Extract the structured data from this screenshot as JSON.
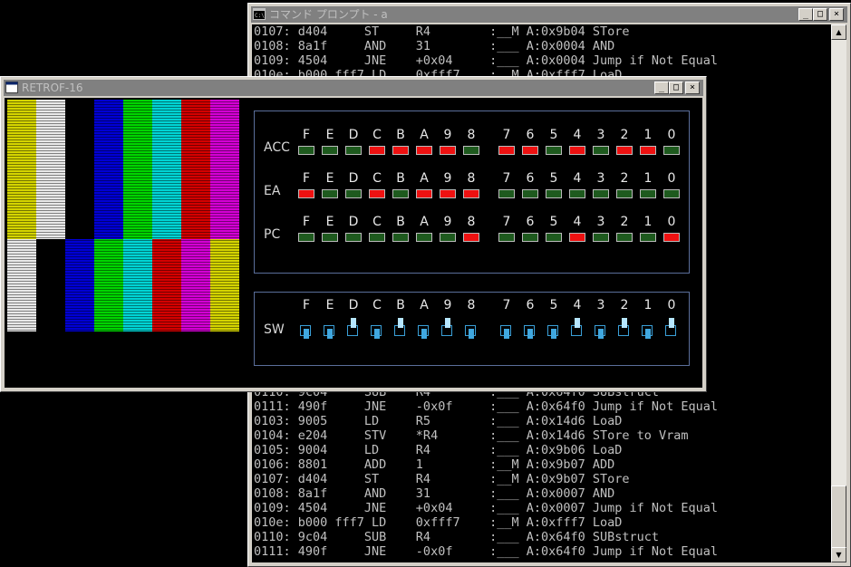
{
  "console": {
    "title": "コマンド プロンプト - a",
    "icon": "cmd-icon",
    "controls": {
      "minimize": "_",
      "maximize": "□",
      "close": "×"
    },
    "lines": [
      "0107: d404     ST     R4        :__M A:0x9b04 STore",
      "0108: 8a1f     AND    31        :___ A:0x0004 AND",
      "0109: 4504     JNE    +0x04     :___ A:0x0004 Jump if Not Equal",
      "010e: b000 fff7 LD    0xfff7    :__M A:0xfff7 LoaD",
      "0110: 9c04     SUB    R4        :___ A:0x64f0 SUBstruct",
      "0111: 490f     JNE    -0x0f     :___ A:0x64f0 Jump if Not Equal",
      "0103: 9005     LD     R5        :___ A:0x14d6 LoaD",
      "0104: e204     STV    *R4       :___ A:0x14d6 STore to Vram",
      "0105: 9004     LD     R4        :___ A:0x9b06 LoaD",
      "0106: 8801     ADD    1         :__M A:0x9b07 ADD",
      "0107: d404     ST     R4        :__M A:0x9b07 STore",
      "0108: 8a1f     AND    31        :___ A:0x0007 AND",
      "0109: 4504     JNE    +0x04     :___ A:0x0007 Jump if Not Equal",
      "010e: b000 fff7 LD    0xfff7    :__M A:0xfff7 LoaD",
      "0110: 9c04     SUB    R4        :___ A:0x64f0 SUBstruct",
      "0111: 490f     JNE    -0x0f     :___ A:0x64f0 Jump if Not Equal"
    ],
    "scroll": {
      "up": "▲",
      "down": "▼"
    }
  },
  "retro": {
    "title": "RETROF-16",
    "icon": "window-icon",
    "controls": {
      "minimize": "_",
      "maximize": "□",
      "close": "×"
    },
    "colors": {
      "white": "#e8e8e8",
      "yellow": "#d4d400",
      "cyan": "#00d4d4",
      "green": "#00d400",
      "magenta": "#d400d4",
      "red": "#d40000",
      "blue": "#0000d4",
      "black": "#000000",
      "led_on": "#ee1111",
      "led_off": "#1e5a1e"
    },
    "color_bars_top": [
      "yellow",
      "white",
      "black",
      "blue",
      "green",
      "cyan",
      "red",
      "magenta"
    ],
    "color_bars_bottom": [
      "white",
      "black",
      "blue",
      "green",
      "cyan",
      "red",
      "magenta",
      "yellow"
    ],
    "bit_labels": [
      "F",
      "E",
      "D",
      "C",
      "B",
      "A",
      "9",
      "8",
      "7",
      "6",
      "5",
      "4",
      "3",
      "2",
      "1",
      "0"
    ],
    "registers": [
      {
        "label": "ACC",
        "bits": [
          0,
          0,
          0,
          1,
          1,
          1,
          1,
          0,
          1,
          1,
          0,
          1,
          0,
          1,
          1,
          0
        ]
      },
      {
        "label": "EA",
        "bits": [
          1,
          0,
          0,
          1,
          0,
          1,
          1,
          1,
          0,
          0,
          0,
          0,
          0,
          0,
          0,
          0
        ]
      },
      {
        "label": "PC",
        "bits": [
          0,
          0,
          0,
          0,
          0,
          0,
          0,
          1,
          0,
          0,
          0,
          1,
          0,
          0,
          0,
          1
        ]
      }
    ],
    "switches": {
      "label": "SW",
      "states": [
        0,
        0,
        1,
        0,
        1,
        0,
        1,
        0,
        0,
        0,
        0,
        1,
        0,
        1,
        0,
        1
      ]
    }
  }
}
